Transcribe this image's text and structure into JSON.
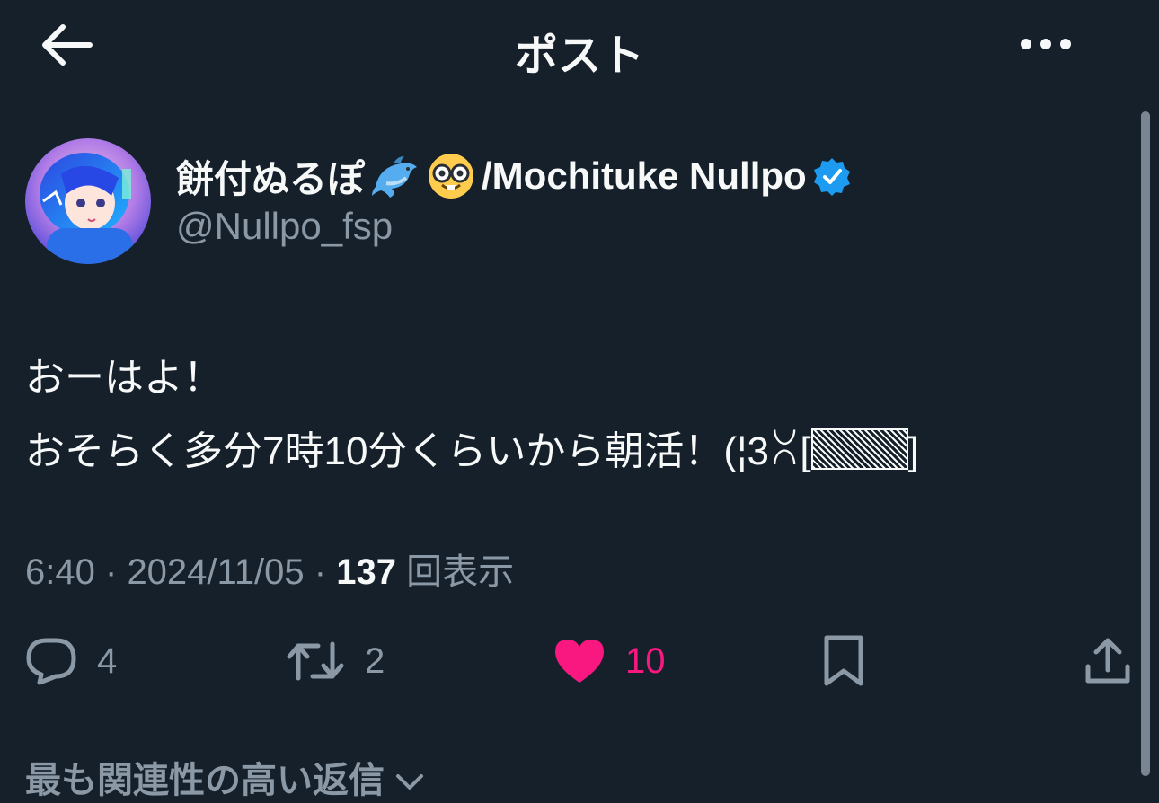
{
  "header": {
    "title": "ポスト",
    "back_icon": "arrow-left-icon",
    "more_icon": "more-horizontal-icon"
  },
  "author": {
    "name_prefix": "餅付ぬるぽ",
    "name_suffix": "/Mochituke Nullpo",
    "emojis": [
      "dolphin-emoji",
      "nerd-face-emoji"
    ],
    "verified": true,
    "handle": "@Nullpo_fsp"
  },
  "tweet": {
    "line1": "おーはよ！",
    "line2_prefix": "おそらく多分7時10分くらいから朝活！(¦3ꇤ[",
    "line2_suffix": "]"
  },
  "meta": {
    "time": "6:40",
    "separator": "·",
    "date": "2024/11/05",
    "views": "137",
    "views_label": "回表示"
  },
  "actions": {
    "reply_count": "4",
    "retweet_count": "2",
    "like_count": "10",
    "liked": true
  },
  "replies_header": {
    "label": "最も関連性の高い返信"
  },
  "colors": {
    "background": "#15202b",
    "text": "#f7f9f9",
    "secondary": "#8b98a5",
    "like": "#f91880",
    "verified": "#1d9bf0"
  }
}
